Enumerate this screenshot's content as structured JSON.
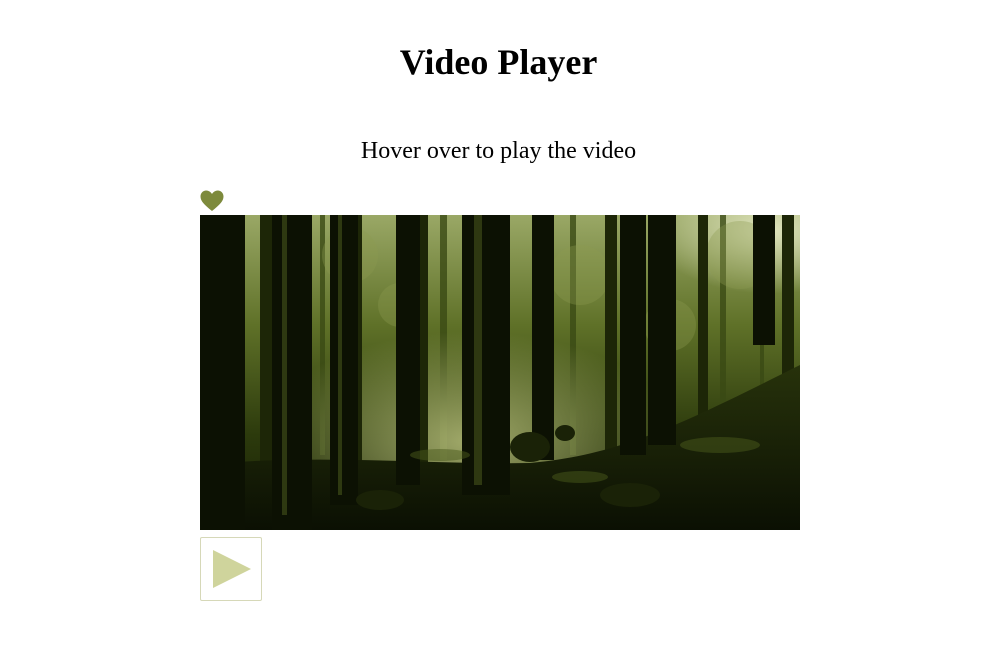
{
  "page": {
    "title": "Video Player",
    "hint": "Hover over to play the video"
  },
  "icons": {
    "favorite": "heart-icon",
    "play": "play-icon"
  },
  "colors": {
    "accent": "#7d8a3c",
    "play_triangle": "#cfd49c",
    "play_border": "#d6d8b8",
    "video_tint": "#3f4f16"
  },
  "video": {
    "scene": "forest"
  }
}
